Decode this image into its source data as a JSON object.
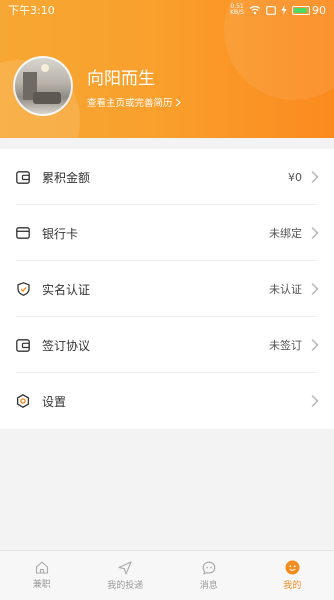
{
  "status_bar": {
    "time": "下午3:10",
    "net_speed_value": "0.51",
    "net_speed_unit": "KB/S",
    "battery": "90"
  },
  "profile": {
    "name": "向阳而生",
    "link": "查看主页或完善简历"
  },
  "menu": [
    {
      "label": "累积金额",
      "value": "¥0",
      "icon": "wallet-icon"
    },
    {
      "label": "银行卡",
      "value": "未绑定",
      "icon": "bank-card-icon"
    },
    {
      "label": "实名认证",
      "value": "未认证",
      "icon": "shield-icon"
    },
    {
      "label": "签订协议",
      "value": "未签订",
      "icon": "contract-icon"
    },
    {
      "label": "设置",
      "value": "",
      "icon": "settings-icon"
    }
  ],
  "tabs": [
    {
      "label": "兼职",
      "icon": "home-icon"
    },
    {
      "label": "我的投递",
      "icon": "send-icon"
    },
    {
      "label": "消息",
      "icon": "message-icon"
    },
    {
      "label": "我的",
      "icon": "profile-icon",
      "active": true
    }
  ],
  "colors": {
    "accent": "#f28c1e",
    "header_start": "#f7a733",
    "header_end": "#fb8a1f"
  }
}
